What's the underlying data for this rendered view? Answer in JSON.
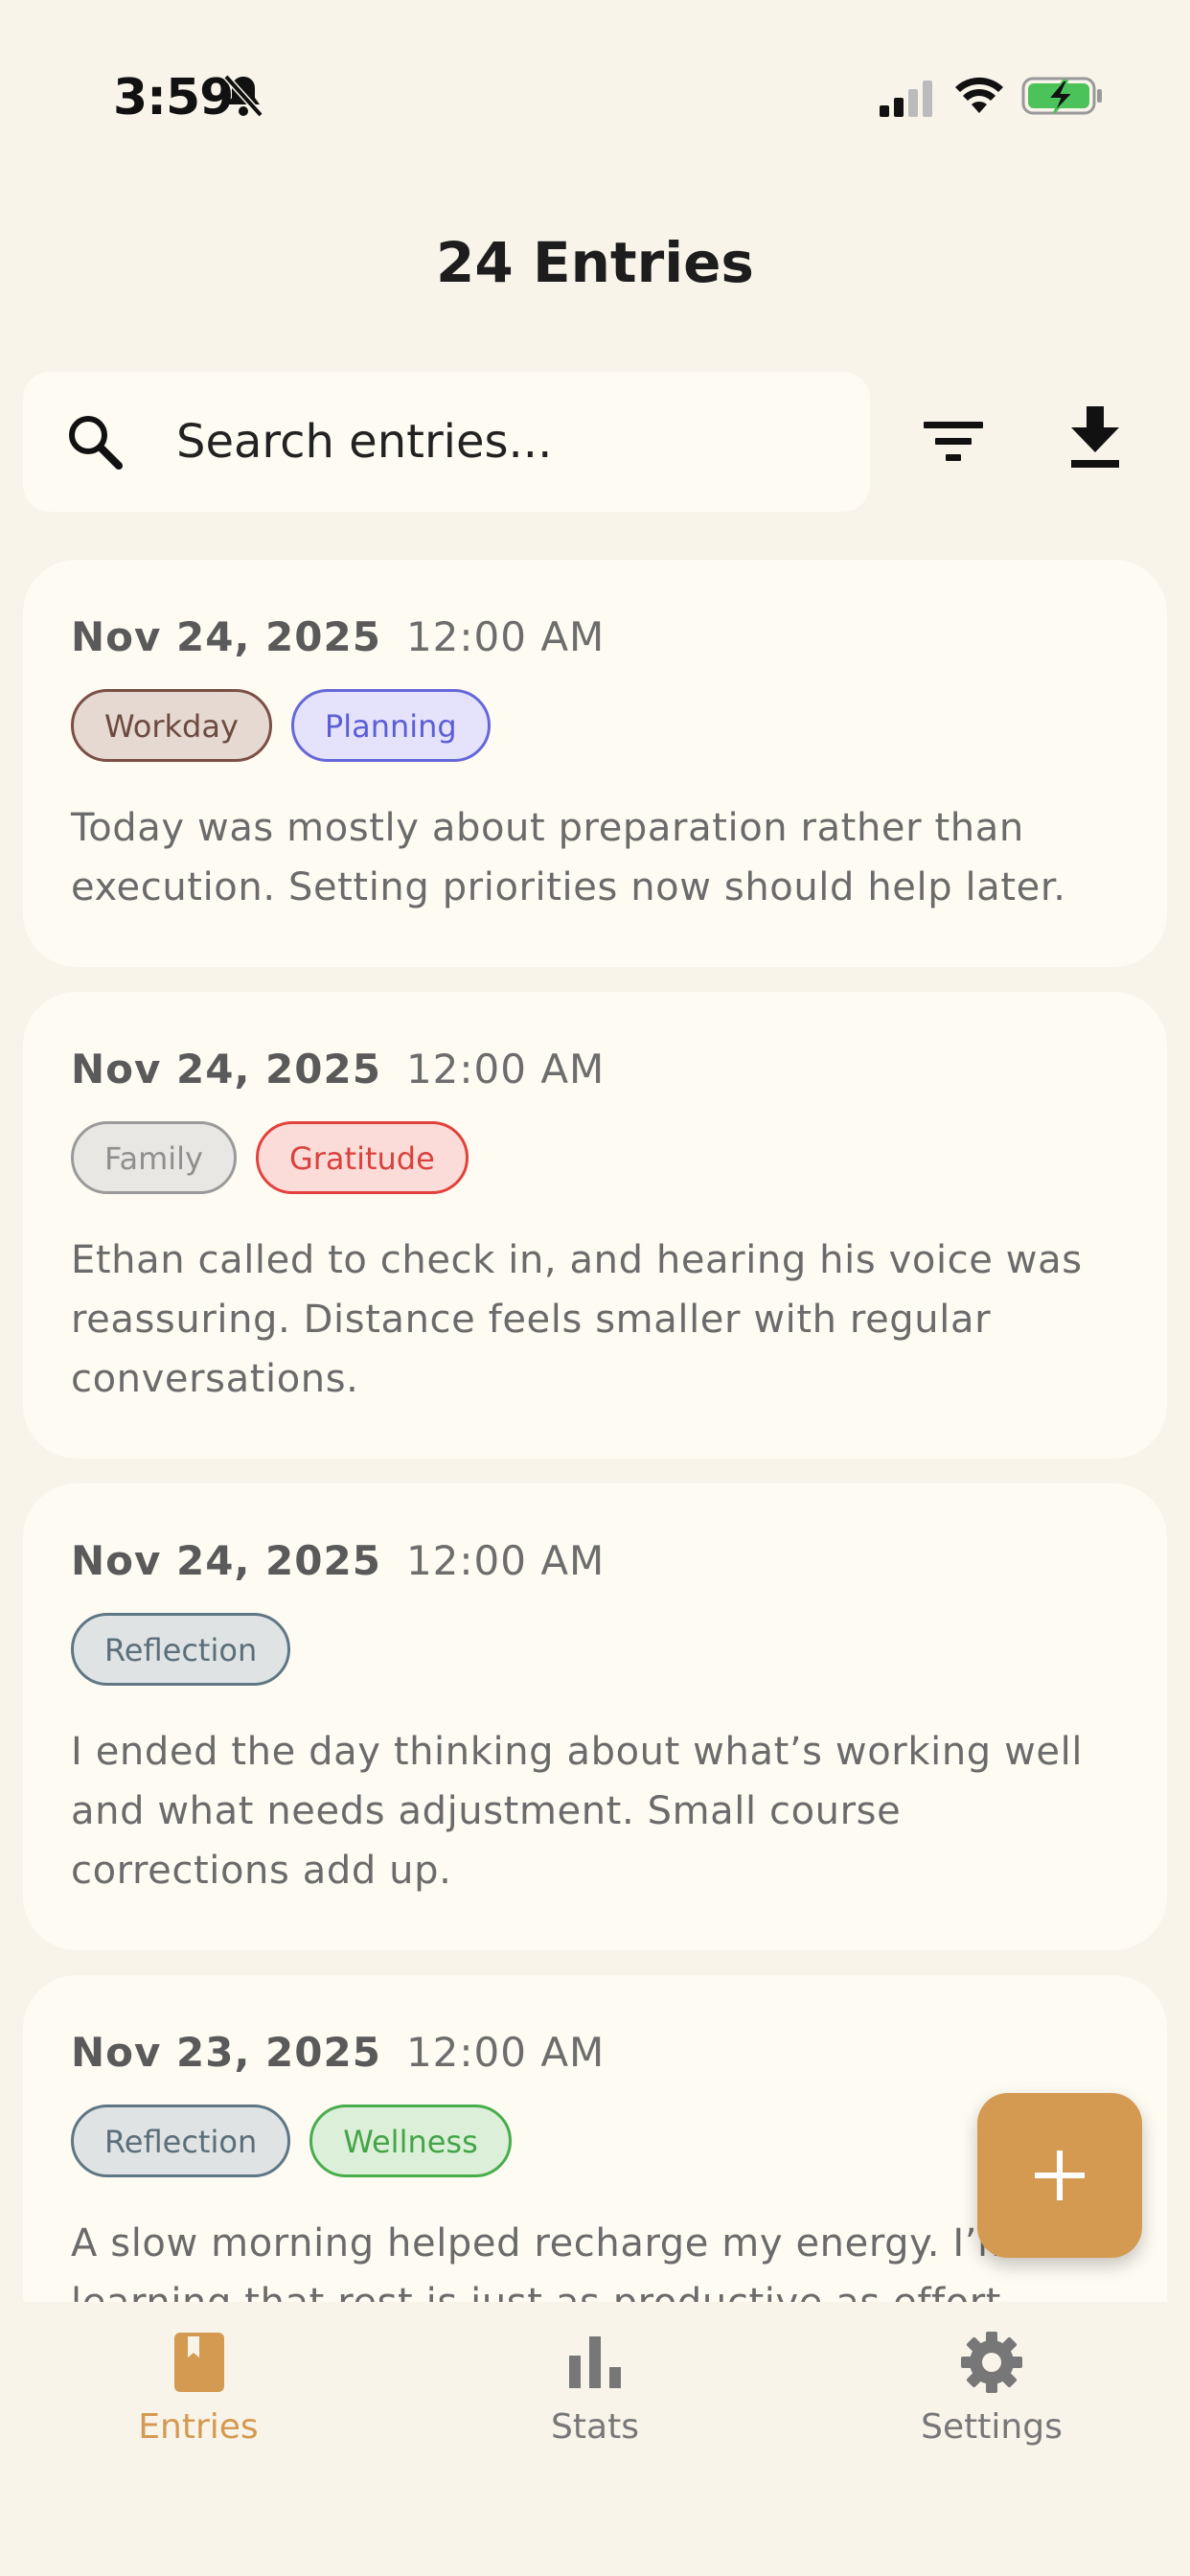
{
  "status_bar": {
    "time": "3:59",
    "icons": [
      "bell-slash-icon",
      "signal-icon",
      "wifi-icon",
      "battery-charging-icon"
    ]
  },
  "header": {
    "title": "24 Entries"
  },
  "search": {
    "placeholder": "Search entries..."
  },
  "toolbar": {
    "icons": [
      "filter-icon",
      "download-icon"
    ]
  },
  "entries": [
    {
      "date": "Nov 24, 2025",
      "time": "12:00 AM",
      "tags": [
        {
          "label": "Workday",
          "bg": "#e5d9d1",
          "border": "#7b4f45",
          "color": "#6d4a3f"
        },
        {
          "label": "Planning",
          "bg": "#e4e3fb",
          "border": "#6668d9",
          "color": "#5c5ed6"
        }
      ],
      "text": "Today was mostly about preparation rather than execution. Setting priorities now should help later."
    },
    {
      "date": "Nov 24, 2025",
      "time": "12:00 AM",
      "tags": [
        {
          "label": "Family",
          "bg": "#e9e7e3",
          "border": "#9a9a9a",
          "color": "#8f8f8f"
        },
        {
          "label": "Gratitude",
          "bg": "#fbdcd9",
          "border": "#e2423b",
          "color": "#d9423d"
        }
      ],
      "text": "Ethan called to check in, and hearing his voice was reassuring. Distance feels smaller with regular conversations."
    },
    {
      "date": "Nov 24, 2025",
      "time": "12:00 AM",
      "tags": [
        {
          "label": "Reflection",
          "bg": "#dfe3e3",
          "border": "#5f7784",
          "color": "#5b6f7a"
        }
      ],
      "text": "I ended the day thinking about what’s working well and what needs adjustment. Small course corrections add up."
    },
    {
      "date": "Nov 23, 2025",
      "time": "12:00 AM",
      "tags": [
        {
          "label": "Reflection",
          "bg": "#dfe3e3",
          "border": "#5f7784",
          "color": "#5b6f7a"
        },
        {
          "label": "Wellness",
          "bg": "#dcefd8",
          "border": "#49ad4c",
          "color": "#43a547"
        }
      ],
      "text": "A slow morning helped recharge my energy. I’m learning that rest is just as productive as effort."
    }
  ],
  "fab": {
    "icon": "plus-icon",
    "color": "#d59a51"
  },
  "bottom_nav": {
    "items": [
      {
        "label": "Entries",
        "icon": "journal-icon",
        "active": true
      },
      {
        "label": "Stats",
        "icon": "bar-chart-icon",
        "active": false
      },
      {
        "label": "Settings",
        "icon": "gear-icon",
        "active": false
      }
    ],
    "active_color": "#d59a51",
    "inactive_color": "#777777"
  }
}
